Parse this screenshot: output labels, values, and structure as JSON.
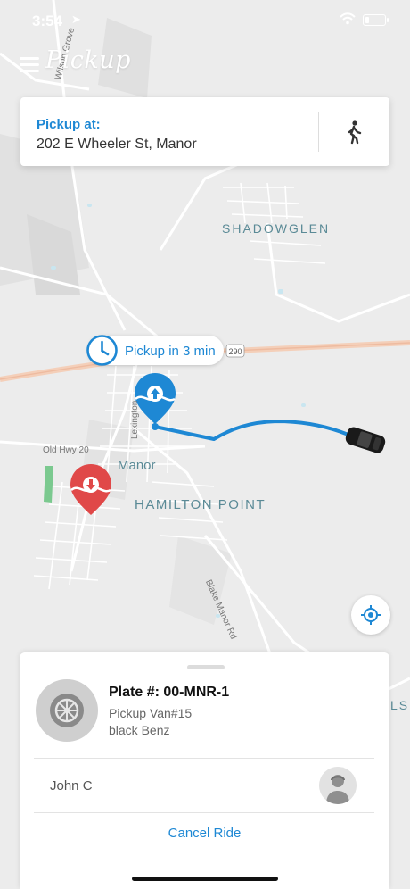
{
  "status": {
    "time": "3:54"
  },
  "header": {
    "app_title": "Pickup"
  },
  "pickup": {
    "label": "Pickup at:",
    "address": "202 E Wheeler St, Manor"
  },
  "eta": {
    "text": "Pickup in 3 min"
  },
  "map": {
    "neighborhoods": [
      "SHADOWGLEN",
      "HAMILTON POINT"
    ],
    "town": "Manor",
    "roads": [
      "Old Hwy 20",
      "Blake Manor Rd",
      "Lexington",
      "Wilson Grove",
      "290"
    ],
    "route_color": "#1e88d4",
    "pickup_marker_color": "#1e88d4",
    "dropoff_marker_color": "#e04848",
    "edge_text": "LS"
  },
  "ride": {
    "plate": "Plate #: 00-MNR-1",
    "vehicle": "Pickup Van#15",
    "description": "black Benz",
    "driver": "John C",
    "cancel_label": "Cancel Ride"
  }
}
